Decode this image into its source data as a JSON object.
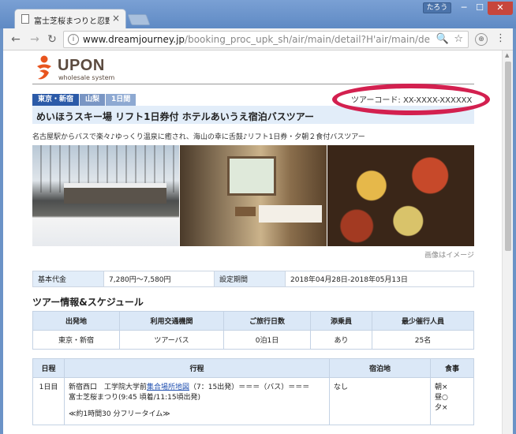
{
  "browser": {
    "tab_title": "富士芝桜まつりと忍野八",
    "tab_close": "×",
    "user_badge": "たろう",
    "min": "─",
    "max": "☐",
    "close": "✕",
    "url_domain": "www.dreamjourney.jp",
    "url_path": "/booking_proc_upk_sh/air/main/detail?H'air/main/detail?HEAD…",
    "info_glyph": "i",
    "ext_glyph": "⊕"
  },
  "logo": {
    "brand": "UPON",
    "tagline": "wholesale system"
  },
  "tags": [
    "東京・新宿",
    "山梨",
    "1日間"
  ],
  "tour_code": "ツアーコード: XX-XXXX-XXXXXX",
  "tour_title": "めいほうスキー場 リフト1日券付 ホテルあいうえ宿泊バスツアー",
  "subtitle": "名古屋駅からバスで楽々♪ゆっくり温泉に癒され、海山の幸に舌鼓♪リフト1日券・夕朝２食付バスツアー",
  "photo_caption": "画像はイメージ",
  "info": {
    "price_label": "基本代金",
    "price_value": "7,280円～7,580円",
    "period_label": "設定期間",
    "period_value": "2018年04月28日-2018年05月13日"
  },
  "section_heading": "ツアー情報&スケジュール",
  "tour_table": {
    "headers": [
      "出発地",
      "利用交通機関",
      "ご旅行日数",
      "添乗員",
      "最少催行人員"
    ],
    "row": [
      "東京・新宿",
      "ツアーバス",
      "0泊1日",
      "あり",
      "25名"
    ]
  },
  "schedule": {
    "headers": [
      "日程",
      "行程",
      "宿泊地",
      "食事"
    ],
    "row": {
      "day": "1日目",
      "line1_pre": "新宿西口　工学院大学前",
      "line1_link": "集合場所地図",
      "line1_post": "（7：15出発）＝＝＝（バス）＝＝＝",
      "line2": "富士芝桜まつり(9:45 頃着/11:15頃出発)",
      "line3": "≪約1時間30 分フリータイム≫",
      "lodging": "なし",
      "meal_b": "朝×",
      "meal_l": "昼○",
      "meal_d": "夕×"
    }
  }
}
